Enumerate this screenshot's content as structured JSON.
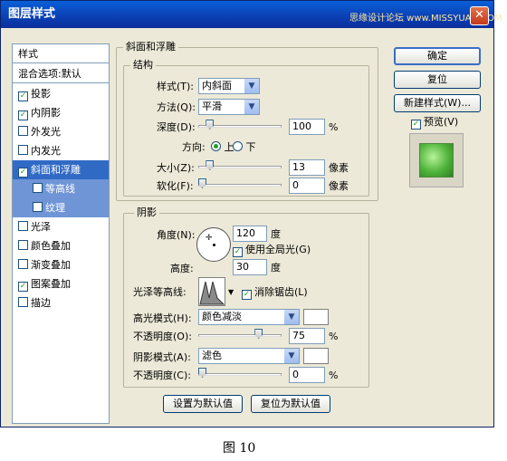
{
  "window": {
    "title": "图层样式",
    "watermark": "思缘设计论坛 www.MISSYUAN.COM"
  },
  "styles_list": {
    "header": "样式",
    "blend": "混合选项:默认",
    "items": [
      {
        "label": "投影",
        "checked": true
      },
      {
        "label": "内阴影",
        "checked": true
      },
      {
        "label": "外发光",
        "checked": false
      },
      {
        "label": "内发光",
        "checked": false
      },
      {
        "label": "斜面和浮雕",
        "checked": true,
        "selected": true
      },
      {
        "label": "等高线",
        "checked": false,
        "sub": true
      },
      {
        "label": "纹理",
        "checked": false,
        "sub": true
      },
      {
        "label": "光泽",
        "checked": false
      },
      {
        "label": "颜色叠加",
        "checked": false
      },
      {
        "label": "渐变叠加",
        "checked": false
      },
      {
        "label": "图案叠加",
        "checked": true
      },
      {
        "label": "描边",
        "checked": false
      }
    ]
  },
  "bevel": {
    "section_title": "斜面和浮雕",
    "structure_title": "结构",
    "style_label": "样式(T):",
    "style_value": "内斜面",
    "technique_label": "方法(Q):",
    "technique_value": "平滑",
    "depth_label": "深度(D):",
    "depth_value": "100",
    "depth_unit": "%",
    "depth_level": 0.1,
    "direction_label": "方向:",
    "direction_up": "上",
    "direction_down": "下",
    "size_label": "大小(Z):",
    "size_value": "13",
    "size_unit": "像素",
    "size_level": 0.1,
    "soften_label": "软化(F):",
    "soften_value": "0",
    "soften_unit": "像素",
    "soften_level": 0.0
  },
  "shading": {
    "title": "阴影",
    "angle_label": "角度(N):",
    "angle_value": "120",
    "angle_unit": "度",
    "global_light_label": "使用全局光(G)",
    "altitude_label": "高度:",
    "altitude_value": "30",
    "altitude_unit": "度",
    "gloss_label": "光泽等高线:",
    "antialias_label": "消除锯齿(L)",
    "highlight_mode_label": "高光模式(H):",
    "highlight_mode_value": "颜色减淡",
    "highlight_opacity_label": "不透明度(O):",
    "highlight_opacity_value": "75",
    "highlight_opacity_unit": "%",
    "highlight_level": 0.75,
    "shadow_mode_label": "阴影模式(A):",
    "shadow_mode_value": "滤色",
    "shadow_opacity_label": "不透明度(C):",
    "shadow_opacity_value": "0",
    "shadow_opacity_unit": "%",
    "shadow_level": 0.0
  },
  "bottom_buttons": {
    "set_default": "设置为默认值",
    "reset_default": "复位为默认值"
  },
  "right_buttons": {
    "ok": "确定",
    "reset": "复位",
    "new_style": "新建样式(W)...",
    "preview": "预览(V)"
  },
  "caption": "图 10"
}
